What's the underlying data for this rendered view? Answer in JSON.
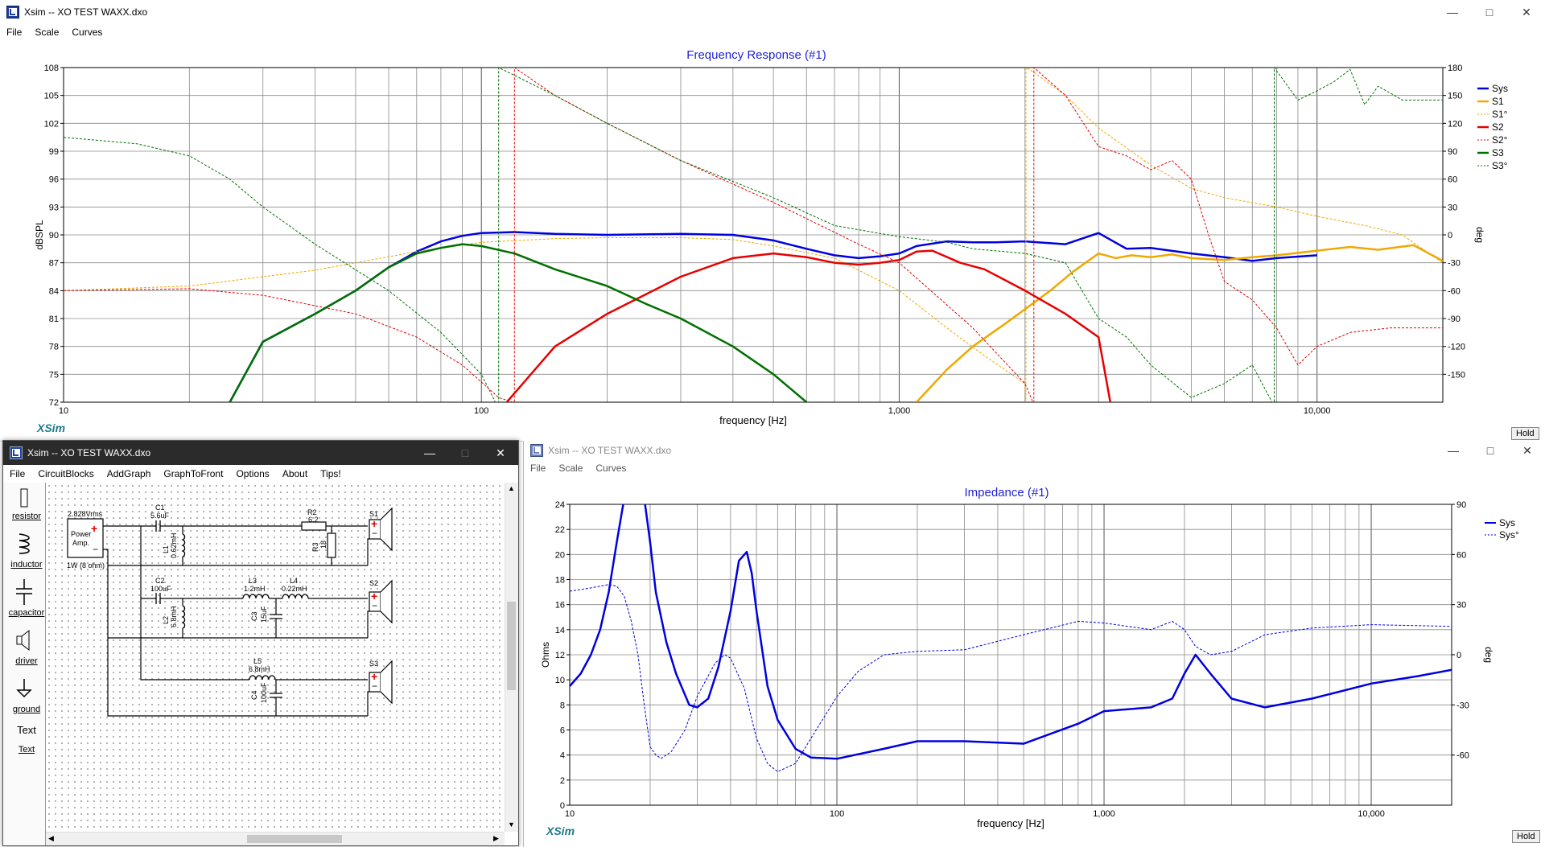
{
  "main_window": {
    "title": "Xsim -- XO TEST WAXX.dxo",
    "menu": [
      "File",
      "Scale",
      "Curves"
    ],
    "graph_title": "Frequency Response (#1)",
    "ylabel_left": "dBSPL",
    "ylabel_right": "deg",
    "xlabel": "frequency [Hz]",
    "logo": "XSim",
    "hold_label": "Hold"
  },
  "schematic_window": {
    "title": "Xsim -- XO TEST WAXX.dxo",
    "menu": [
      "File",
      "CircuitBlocks",
      "AddGraph",
      "GraphToFront",
      "Options",
      "About",
      "Tips!"
    ],
    "tools": [
      "resistor",
      "inductor",
      "capacitor",
      "driver",
      "ground",
      "Text",
      "Text"
    ],
    "source": {
      "voltage": "2.828Vrms",
      "label1": "Power",
      "label2": "Amp.",
      "rating": "1W (8 ohm)"
    },
    "components": {
      "C1": {
        "name": "C1",
        "value": "5.6uF"
      },
      "L1": {
        "name": "L1",
        "value": "0.62mH"
      },
      "R2": {
        "name": "R2",
        "value": "6.2"
      },
      "R3": {
        "name": "R3",
        "value": "18"
      },
      "C2": {
        "name": "C2",
        "value": "100uF"
      },
      "L2": {
        "name": "L2",
        "value": "6.8mH"
      },
      "L3": {
        "name": "L3",
        "value": "1.2mH"
      },
      "L4": {
        "name": "L4",
        "value": "0.22mH"
      },
      "C3": {
        "name": "C3",
        "value": "15uF"
      },
      "L5": {
        "name": "L5",
        "value": "6.8mH"
      },
      "C4": {
        "name": "C4",
        "value": "100uF"
      }
    },
    "drivers": [
      "S1",
      "S2",
      "S3"
    ]
  },
  "impedance_window": {
    "title": "Xsim -- XO TEST WAXX.dxo",
    "menu": [
      "File",
      "Scale",
      "Curves"
    ],
    "graph_title": "Impedance (#1)",
    "ylabel_left": "Ohms",
    "ylabel_right": "deg",
    "xlabel": "frequency [Hz]",
    "logo": "XSim",
    "hold_label": "Hold"
  },
  "chart_data": [
    {
      "type": "line",
      "title": "Frequency Response (#1)",
      "xlabel": "frequency [Hz]",
      "ylabel": "dBSPL",
      "y2label": "deg",
      "xscale": "log",
      "xlim": [
        10,
        20000
      ],
      "ylim": [
        72,
        108
      ],
      "y2lim": [
        -180,
        180
      ],
      "xticks": [
        "10",
        "100",
        "1,000",
        "10,000"
      ],
      "yticks": [
        72,
        75,
        78,
        81,
        84,
        87,
        90,
        93,
        96,
        99,
        102,
        105,
        108
      ],
      "y2ticks": [
        -150,
        -120,
        -90,
        -60,
        -30,
        0,
        30,
        60,
        90,
        120,
        150,
        180
      ],
      "grid": true,
      "legend": "right",
      "series": [
        {
          "name": "Sys",
          "axis": "left",
          "style": "solid",
          "color": "#0000e0",
          "width": 2.5,
          "x": [
            25,
            30,
            40,
            50,
            60,
            70,
            80,
            90,
            100,
            120,
            150,
            200,
            300,
            400,
            500,
            600,
            700,
            800,
            900,
            1000,
            1100,
            1300,
            1500,
            1700,
            2000,
            2500,
            3000,
            3500,
            4000,
            5000,
            6000,
            7000,
            8000,
            10000
          ],
          "y": [
            72,
            78.5,
            81.5,
            84,
            86.5,
            88.2,
            89.3,
            89.9,
            90.2,
            90.3,
            90.1,
            90,
            90.1,
            90,
            89.4,
            88.5,
            87.8,
            87.5,
            87.7,
            88,
            88.8,
            89.3,
            89.2,
            89.2,
            89.3,
            89,
            90.2,
            88.5,
            88.6,
            88,
            87.6,
            87.2,
            87.5,
            87.8
          ]
        },
        {
          "name": "S1",
          "axis": "left",
          "style": "solid",
          "color": "#f0a800",
          "width": 2.5,
          "x": [
            1100,
            1300,
            1500,
            1800,
            2000,
            2300,
            2600,
            3000,
            3300,
            3600,
            4000,
            4500,
            5000,
            6000,
            7000,
            8000,
            10000,
            12000,
            14000,
            17000,
            20000
          ],
          "y": [
            72,
            75.5,
            78,
            80.5,
            82,
            84,
            86,
            88,
            87.5,
            87.8,
            87.6,
            87.9,
            87.5,
            87.3,
            87.6,
            87.8,
            88.3,
            88.7,
            88.4,
            88.9,
            87.2
          ]
        },
        {
          "name": "S1°",
          "axis": "right",
          "style": "dashed",
          "color": "#f0a800",
          "width": 1,
          "x": [
            10,
            20,
            40,
            70,
            100,
            150,
            200,
            300,
            400,
            500,
            700,
            1000,
            1300,
            1600,
            2000,
            2010,
            2100,
            2500,
            3000,
            4000,
            5000,
            6000,
            8000,
            10000,
            13000,
            16000,
            20000
          ],
          "y": [
            -60,
            -55,
            -38,
            -18,
            -8,
            -4,
            -3,
            -3,
            -5,
            -12,
            -25,
            -60,
            -100,
            -130,
            -160,
            180,
            175,
            150,
            115,
            75,
            50,
            40,
            30,
            20,
            10,
            0,
            -30
          ]
        },
        {
          "name": "S2",
          "axis": "left",
          "style": "solid",
          "color": "#e80000",
          "width": 2.5,
          "x": [
            115,
            150,
            200,
            300,
            400,
            500,
            600,
            700,
            800,
            900,
            1000,
            1100,
            1200,
            1400,
            1600,
            2000,
            2500,
            3000,
            3200
          ],
          "y": [
            72,
            78,
            81.5,
            85.5,
            87.5,
            88,
            87.6,
            87,
            86.8,
            87,
            87.3,
            88.2,
            88.3,
            87,
            86.3,
            84,
            81.5,
            79,
            72
          ]
        },
        {
          "name": "S2°",
          "axis": "right",
          "style": "dashed",
          "color": "#e80000",
          "width": 1,
          "x": [
            10,
            20,
            30,
            50,
            70,
            90,
            110,
            119,
            120,
            150,
            200,
            300,
            500,
            800,
            1000,
            1500,
            2000,
            2090,
            2100,
            2500,
            3000,
            3500,
            4000,
            4500,
            5000,
            5500,
            6000,
            7000,
            8000,
            9000,
            10000,
            12000,
            15000,
            20000
          ],
          "y": [
            -60,
            -58,
            -65,
            -85,
            -110,
            -140,
            -175,
            -180,
            180,
            150,
            120,
            80,
            35,
            -10,
            -30,
            -100,
            -160,
            -180,
            180,
            150,
            95,
            85,
            70,
            80,
            60,
            0,
            -50,
            -70,
            -100,
            -140,
            -120,
            -105,
            -100,
            -100
          ]
        },
        {
          "name": "S3",
          "axis": "left",
          "style": "solid",
          "color": "#007000",
          "width": 2.5,
          "x": [
            25,
            30,
            40,
            50,
            60,
            70,
            80,
            90,
            100,
            120,
            150,
            200,
            250,
            300,
            400,
            500,
            600
          ],
          "y": [
            72,
            78.5,
            81.5,
            84,
            86.5,
            88,
            88.6,
            89,
            88.8,
            88,
            86.3,
            84.5,
            82.5,
            81,
            78,
            75,
            72
          ]
        },
        {
          "name": "S3°",
          "axis": "right",
          "style": "dashed",
          "color": "#007000",
          "width": 1,
          "x": [
            10,
            15,
            20,
            25,
            30,
            40,
            60,
            80,
            100,
            108,
            110,
            150,
            200,
            300,
            500,
            700,
            1000,
            1300,
            1500,
            2000,
            2500,
            3000,
            3500,
            4000,
            5000,
            6000,
            7000,
            7800,
            7900,
            9000,
            10000,
            11000,
            12000,
            13000,
            14000,
            16000,
            20000
          ],
          "y": [
            105,
            98,
            85,
            60,
            30,
            -10,
            -60,
            -105,
            -150,
            -180,
            180,
            150,
            120,
            80,
            40,
            10,
            -2,
            -8,
            -15,
            -20,
            -30,
            -90,
            -110,
            -140,
            -175,
            -160,
            -140,
            -180,
            180,
            145,
            155,
            165,
            178,
            140,
            160,
            145,
            145
          ]
        }
      ]
    },
    {
      "type": "line",
      "title": "Impedance (#1)",
      "xlabel": "frequency [Hz]",
      "ylabel": "Ohms",
      "y2label": "deg",
      "xscale": "log",
      "xlim": [
        10,
        20000
      ],
      "ylim": [
        0,
        24
      ],
      "y2lim": [
        -90,
        90
      ],
      "xticks": [
        "10",
        "100",
        "1,000",
        "10,000"
      ],
      "yticks": [
        0,
        2,
        4,
        6,
        8,
        10,
        12,
        14,
        16,
        18,
        20,
        22,
        24
      ],
      "y2ticks": [
        -60,
        -30,
        0,
        30,
        60,
        90
      ],
      "grid": true,
      "legend": "right",
      "series": [
        {
          "name": "Sys",
          "axis": "left",
          "style": "solid",
          "color": "#0000e0",
          "width": 2.5,
          "x": [
            10,
            11,
            12,
            13,
            14,
            15,
            16,
            17,
            19,
            20,
            21,
            23,
            25,
            28,
            30,
            33,
            36,
            40,
            43,
            46,
            48,
            50,
            55,
            60,
            70,
            80,
            100,
            150,
            200,
            300,
            500,
            800,
            1000,
            1500,
            1800,
            2000,
            2200,
            2500,
            3000,
            4000,
            6000,
            10000,
            15000,
            20000
          ],
          "y": [
            9.5,
            10.5,
            12,
            14,
            17,
            21,
            24.5,
            24.5,
            24.5,
            21,
            17,
            13,
            10.5,
            8,
            7.8,
            8.5,
            11,
            15.5,
            19.5,
            20.2,
            18.5,
            15.5,
            9.5,
            6.8,
            4.5,
            3.8,
            3.7,
            4.5,
            5.1,
            5.1,
            4.9,
            6.5,
            7.5,
            7.8,
            8.5,
            10.5,
            12,
            10.5,
            8.5,
            7.8,
            8.5,
            9.7,
            10.3,
            10.8
          ]
        },
        {
          "name": "Sys°",
          "axis": "right",
          "style": "dashed",
          "color": "#0000e0",
          "width": 1,
          "x": [
            10,
            12,
            14,
            15,
            16,
            17,
            18,
            19,
            20,
            21,
            22,
            24,
            27,
            30,
            35,
            38,
            40,
            45,
            50,
            55,
            60,
            70,
            80,
            100,
            120,
            150,
            200,
            300,
            500,
            800,
            1000,
            1500,
            1800,
            2000,
            2200,
            2500,
            3000,
            4000,
            6000,
            10000,
            20000
          ],
          "y": [
            38,
            40,
            42,
            41,
            35,
            20,
            0,
            -30,
            -55,
            -60,
            -62,
            -58,
            -45,
            -25,
            -5,
            0,
            -2,
            -20,
            -50,
            -65,
            -70,
            -65,
            -50,
            -25,
            -10,
            0,
            2,
            3,
            12,
            20,
            19,
            15,
            20,
            15,
            5,
            0,
            2,
            12,
            16,
            18,
            17
          ]
        }
      ]
    }
  ]
}
